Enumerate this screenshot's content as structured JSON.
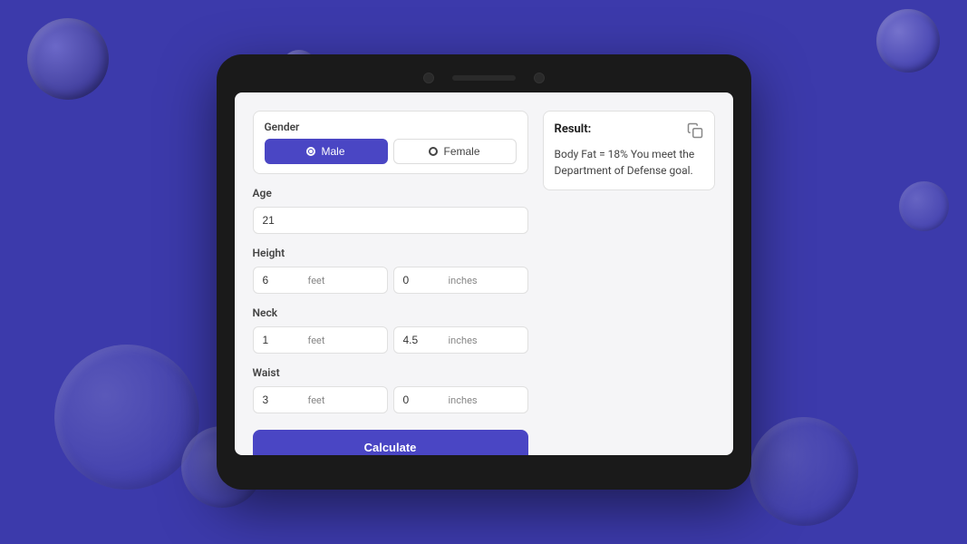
{
  "background_color": "#3c3aab",
  "gender_label": "Gender",
  "gender_options": [
    {
      "id": "male",
      "label": "Male",
      "active": true
    },
    {
      "id": "female",
      "label": "Female",
      "active": false
    }
  ],
  "age_label": "Age",
  "age_value": "21",
  "height_label": "Height",
  "height_feet_value": "6",
  "height_feet_unit": "feet",
  "height_inches_value": "0",
  "height_inches_unit": "inches",
  "neck_label": "Neck",
  "neck_feet_value": "1",
  "neck_feet_unit": "feet",
  "neck_inches_value": "4.5",
  "neck_inches_unit": "inches",
  "waist_label": "Waist",
  "waist_feet_value": "3",
  "waist_feet_unit": "feet",
  "waist_inches_value": "0",
  "waist_inches_unit": "inches",
  "calculate_label": "Calculate",
  "result_title": "Result:",
  "result_text": "Body Fat = 18% You meet the Department of Defense goal."
}
